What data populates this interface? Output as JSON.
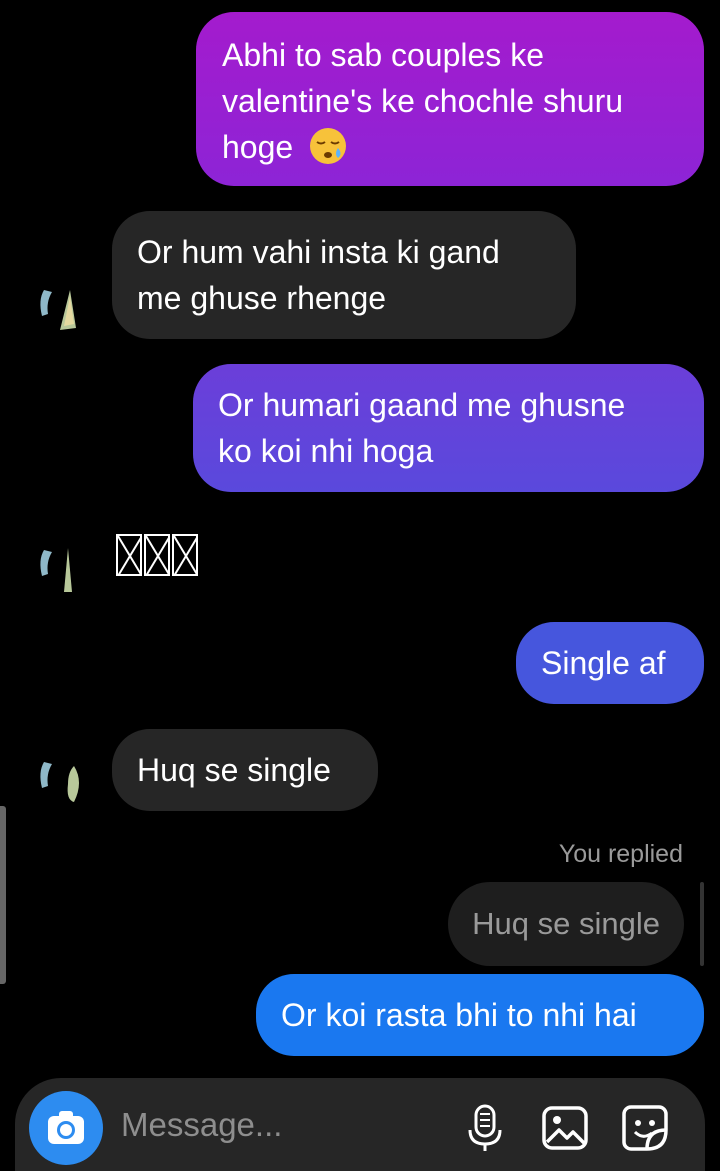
{
  "messages": {
    "m1": {
      "line1": "Abhi to sab couples ke",
      "line2": "valentine's ke chochle shuru",
      "line3": "hoge",
      "emoji": "sleepy-face-emoji"
    },
    "m2": {
      "line1": "Or hum vahi insta ki gand",
      "line2": "me ghuse rhenge"
    },
    "m3": {
      "line1": "Or humari gaand me ghusne",
      "line2": "ko koi nhi hoga"
    },
    "m5": {
      "text": "Single af"
    },
    "m6": {
      "text": "Huq se single"
    },
    "m7": {
      "text": "Or koi rasta bhi to nhi hai"
    }
  },
  "reply": {
    "label": "You replied",
    "quote": "Huq se single"
  },
  "composer": {
    "placeholder": "Message...",
    "icons": [
      "camera-icon",
      "microphone-icon",
      "gallery-icon",
      "sticker-icon"
    ]
  },
  "colors": {
    "incoming": "#262626",
    "composer_bg": "#262626",
    "camera_button": "#2d8cf0",
    "out_1": "#9b1fd0",
    "out_2": "#6a3fd8",
    "out_3": "#4a56dc",
    "out_4": "#1a78f0"
  }
}
